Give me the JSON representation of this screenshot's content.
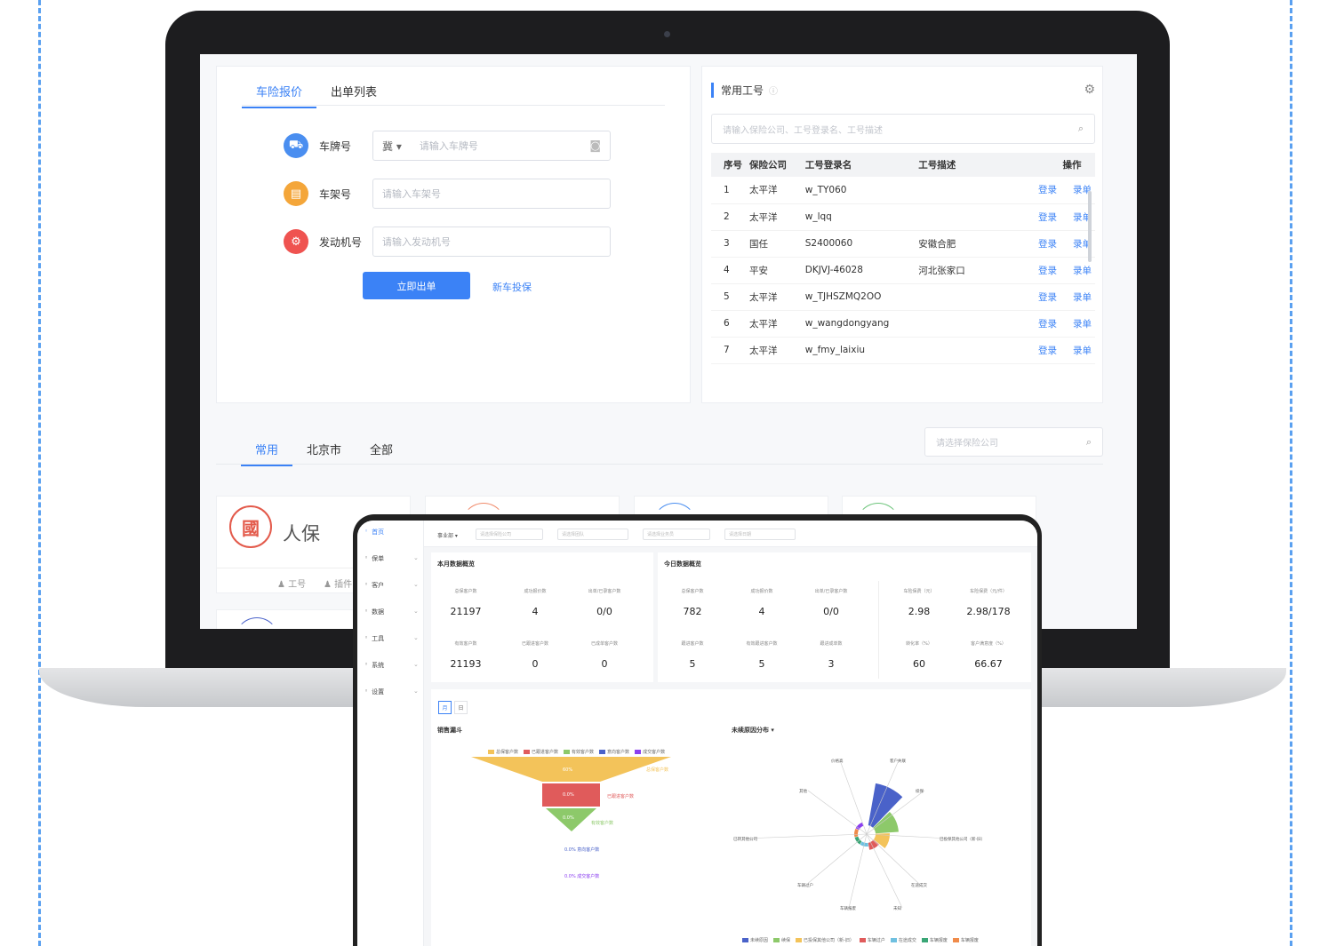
{
  "laptop": {
    "main_tabs": [
      {
        "label": "车险报价",
        "active": true
      },
      {
        "label": "出单列表",
        "active": false
      }
    ],
    "form": {
      "rows": [
        {
          "icon": "car-icon",
          "label": "车牌号",
          "province": "冀",
          "placeholder": "请输入车牌号",
          "color": "#4a8ef0"
        },
        {
          "icon": "frame-icon",
          "label": "车架号",
          "placeholder": "请输入车架号",
          "color": "#f4a63a"
        },
        {
          "icon": "engine-icon",
          "label": "发动机号",
          "placeholder": "请输入发动机号",
          "color": "#ef5350"
        }
      ],
      "submit_label": "立即出单",
      "new_car_link": "新车投保"
    },
    "work_ids": {
      "title": "常用工号",
      "search_placeholder": "请输入保险公司、工号登录名、工号描述",
      "columns": [
        "序号",
        "保险公司",
        "工号登录名",
        "工号描述",
        "操作"
      ],
      "rows": [
        {
          "no": "1",
          "company": "太平洋",
          "login": "w_TY060",
          "desc": "",
          "action_login": "登录",
          "action_record": "录单"
        },
        {
          "no": "2",
          "company": "太平洋",
          "login": "w_lqq",
          "desc": "",
          "action_login": "登录",
          "action_record": "录单"
        },
        {
          "no": "3",
          "company": "国任",
          "login": "S2400060",
          "desc": "安徽合肥",
          "action_login": "登录",
          "action_record": "录单"
        },
        {
          "no": "4",
          "company": "平安",
          "login": "DKJVJ-46028",
          "desc": "河北张家口",
          "action_login": "登录",
          "action_record": "录单"
        },
        {
          "no": "5",
          "company": "太平洋",
          "login": "w_TJHSZMQ2OO",
          "desc": "",
          "action_login": "登录",
          "action_record": "录单"
        },
        {
          "no": "6",
          "company": "太平洋",
          "login": "w_wangdongyang",
          "desc": "",
          "action_login": "登录",
          "action_record": "录单"
        },
        {
          "no": "7",
          "company": "太平洋",
          "login": "w_fmy_laixiu",
          "desc": "",
          "action_login": "登录",
          "action_record": "录单"
        }
      ]
    },
    "company_tabs": [
      {
        "label": "常用",
        "active": true
      },
      {
        "label": "北京市",
        "active": false
      },
      {
        "label": "全部",
        "active": false
      }
    ],
    "company_search_placeholder": "请选择保险公司",
    "company_card": {
      "seal": "國",
      "name": "人保",
      "action_1": "工号",
      "action_2": "插件"
    }
  },
  "tablet": {
    "sidebar": [
      {
        "label": "首页",
        "active": true
      },
      {
        "label": "保单",
        "active": false
      },
      {
        "label": "客户",
        "active": false
      },
      {
        "label": "数据",
        "active": false
      },
      {
        "label": "工具",
        "active": false
      },
      {
        "label": "系统",
        "active": false
      },
      {
        "label": "设置",
        "active": false
      }
    ],
    "filters": [
      {
        "label": "事业部"
      },
      {
        "placeholder": "请选择保险公司"
      },
      {
        "placeholder": "请选择团队"
      },
      {
        "placeholder": "请选择业务员"
      },
      {
        "placeholder": "请选择日期"
      }
    ],
    "month_title": "本月数据概览",
    "today_title": "今日数据概览",
    "month_stats": [
      {
        "label": "总保客户数",
        "value": "21197"
      },
      {
        "label": "成功报价数",
        "value": "4"
      },
      {
        "label": "出单/已录客户数",
        "value": "0/0"
      },
      {
        "label": "有效客户数",
        "value": "21193"
      },
      {
        "label": "已跟进客户数",
        "value": "0"
      },
      {
        "label": "已成单客户数",
        "value": "0"
      }
    ],
    "today_stats": [
      {
        "label": "总保客户数",
        "value": "782"
      },
      {
        "label": "成功报价数",
        "value": "4"
      },
      {
        "label": "出单/已录客户数",
        "value": "0/0"
      },
      {
        "label": "跟进客户数",
        "value": "5"
      },
      {
        "label": "有效跟进客户数",
        "value": "5"
      },
      {
        "label": "跟进成单数",
        "value": "3"
      }
    ],
    "premium_stats": [
      {
        "label": "车险保费（元）",
        "value": "2.98"
      },
      {
        "label": "车险保费（元/件）",
        "value": "2.98/178"
      },
      {
        "label": "转化率（%）",
        "value": "60"
      },
      {
        "label": "客户满意度（%）",
        "value": "66.67"
      }
    ],
    "switches": [
      "月",
      "日"
    ],
    "funnel": {
      "title": "销售漏斗",
      "legend": [
        {
          "name": "总保客户数",
          "color": "#f3c35a"
        },
        {
          "name": "已跟进客户数",
          "color": "#e05b5b"
        },
        {
          "name": "有效客户数",
          "color": "#8dc96a"
        },
        {
          "name": "意向客户数",
          "color": "#4a62c9"
        },
        {
          "name": "成交客户数",
          "color": "#8b3ff0"
        }
      ],
      "labels": [
        "总保客户数",
        "已跟进客户数",
        "有效客户数",
        "0.0% 意向客户数",
        "0.0% 成交客户数"
      ],
      "inner_labels": [
        "60%",
        "0.0%",
        "0.0%"
      ]
    },
    "rose": {
      "title": "未续原因分布",
      "labels": [
        "价格高",
        "客户失联",
        "其他",
        "已转其他公司",
        "续保",
        "已投保其他公司（新-旧）",
        "在途成交",
        "车辆过户",
        "车辆报废",
        "未知"
      ],
      "legend": [
        "未续原因",
        "续保",
        "已投保其他公司（新-旧）",
        "车辆过户",
        "在途成交",
        "车辆报废",
        "车辆报废"
      ]
    }
  }
}
